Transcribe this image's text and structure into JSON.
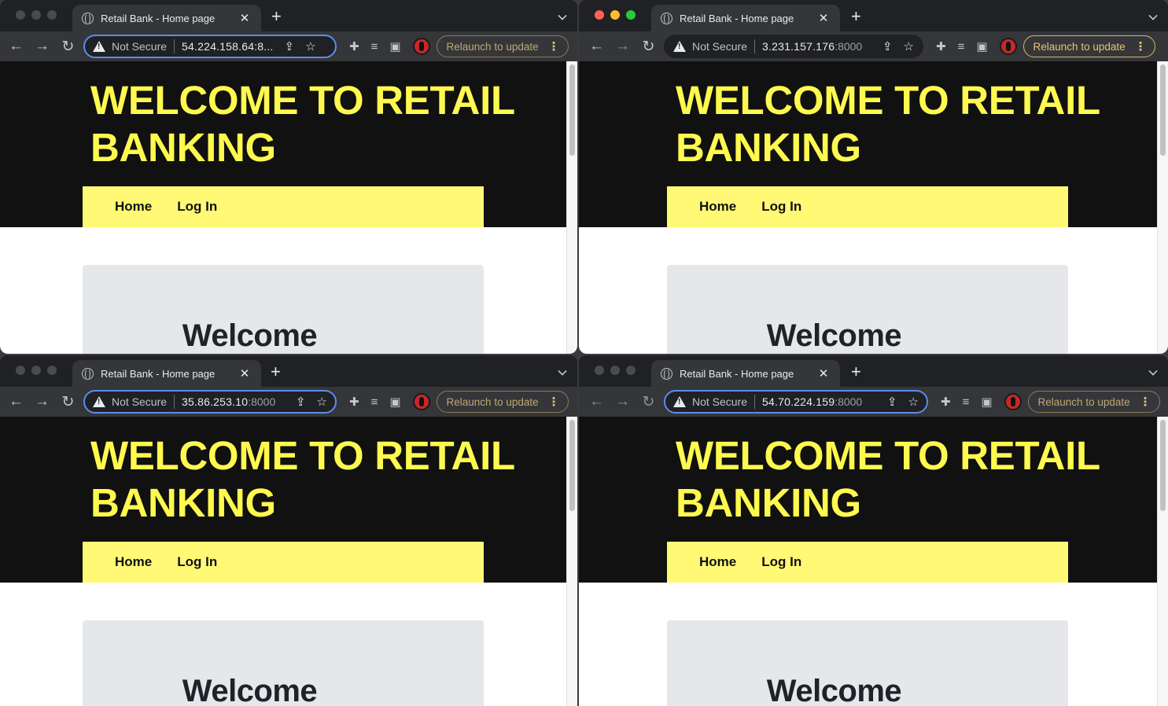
{
  "windows": [
    {
      "id": "top-left",
      "tab_title": "Retail Bank - Home page",
      "security_label": "Not Secure",
      "url_host": "54.224.158.64:8...",
      "url_port": "",
      "relaunch_label": "Relaunch to update",
      "focused": false
    },
    {
      "id": "top-right",
      "tab_title": "Retail Bank - Home page",
      "security_label": "Not Secure",
      "url_host": "3.231.157.176",
      "url_port": ":8000",
      "relaunch_label": "Relaunch to update",
      "focused": true
    },
    {
      "id": "bottom-left",
      "tab_title": "Retail Bank - Home page",
      "security_label": "Not Secure",
      "url_host": "35.86.253.10",
      "url_port": ":8000",
      "relaunch_label": "Relaunch to update",
      "focused": false
    },
    {
      "id": "bottom-right",
      "tab_title": "Retail Bank - Home page",
      "security_label": "Not Secure",
      "url_host": "54.70.224.159",
      "url_port": ":8000",
      "relaunch_label": "Relaunch to update",
      "focused": false
    }
  ],
  "site": {
    "title_line1": "WELCOME TO RETAIL",
    "title_line2": "BANKING",
    "nav": [
      "Home",
      "Log In"
    ],
    "card_title": "Welcome"
  },
  "icons": {
    "back": "arrow-left-icon",
    "forward": "arrow-right-icon",
    "reload": "reload-icon",
    "warning": "warning-triangle-icon",
    "share": "share-icon",
    "bookmark": "star-icon",
    "extensions": "puzzle-icon",
    "reading_list": "reading-list-icon",
    "side_panel": "side-panel-icon",
    "profile": "profile-avatar-icon",
    "menu": "kebab-menu-icon"
  },
  "colors": {
    "site_accent": "#fff94f",
    "nav_bar": "#fff976",
    "header_bg": "#111111",
    "card_bg": "#e5e7eb",
    "omnibox_focus": "#5a8df0",
    "relaunch": "#e9c46a"
  }
}
